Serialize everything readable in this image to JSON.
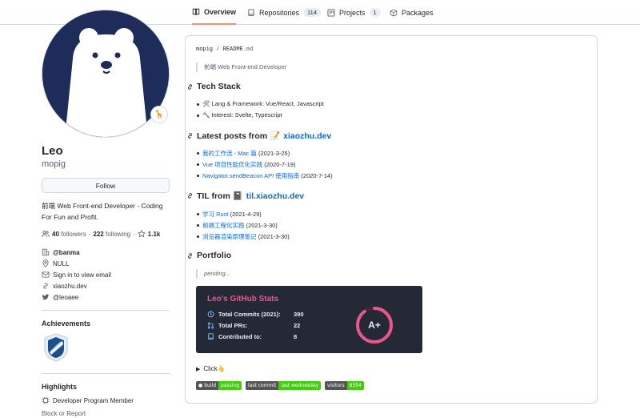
{
  "tabs": [
    {
      "label": "Overview",
      "icon": "book-icon",
      "active": true
    },
    {
      "label": "Repositories",
      "icon": "repo-icon",
      "count": "114"
    },
    {
      "label": "Projects",
      "icon": "project-icon",
      "count": "1"
    },
    {
      "label": "Packages",
      "icon": "package-icon"
    }
  ],
  "profile": {
    "status_emoji": "🦒",
    "name": "Leo",
    "login": "mopig",
    "follow_label": "Follow",
    "bio": "前端 Web Front-end Developer - Coding For Fun and Profit.",
    "followers_count": "40",
    "followers_label": "followers",
    "following_count": "222",
    "following_label": "following",
    "stars_count": "1.1k",
    "org": "@banma",
    "location": "NULL",
    "email": "Sign in to view email",
    "website": "xiaozhu.dev",
    "twitter": "@leoaee"
  },
  "achievements": {
    "heading": "Achievements"
  },
  "highlights": {
    "heading": "Highlights",
    "item": "Developer Program Member"
  },
  "block_label": "Block or Report",
  "readme": {
    "crumb_user": "mopig",
    "crumb_sep": "/",
    "crumb_file": "README",
    "crumb_ext": ".md",
    "intro": "前端 Web Front-end Developer",
    "tech_heading": "Tech Stack",
    "tech_items": [
      "🛠 Lang & Framework: Vue/React, Javascript",
      "🔨 Interest: Svelte, Typescript"
    ],
    "posts_heading_prefix": "Latest posts from 📝",
    "posts_heading_link": "xiaozhu.dev",
    "posts": [
      {
        "title": "我的工作流 - Mac 篇",
        "date": "(2021-3-25)"
      },
      {
        "title": "Vue 项目性能优化实践",
        "date": "(2020-7-19)"
      },
      {
        "title": "Navigator.sendBeacon API 使用指南",
        "date": "(2020-7-14)"
      }
    ],
    "til_heading_prefix": "TIL from 📓",
    "til_heading_link": "til.xiaozhu.dev",
    "til": [
      {
        "title": "学习 Rust",
        "date": "(2021-4-29)"
      },
      {
        "title": "前端工程化实践",
        "date": "(2021-3-30)"
      },
      {
        "title": "浏览器渲染原理笔记",
        "date": "(2021-3-30)"
      }
    ],
    "portfolio_heading": "Portfolio",
    "pending": "pending...",
    "click_label": "Click👆"
  },
  "stats": {
    "title": "Leo's GitHub Stats",
    "rows": [
      {
        "label": "Total Commits (2021):",
        "value": "390",
        "icon": "history-icon"
      },
      {
        "label": "Total PRs:",
        "value": "22",
        "icon": "pull-request-icon"
      },
      {
        "label": "Contributed to:",
        "value": "8",
        "icon": "repo-icon"
      }
    ],
    "rank": "A+",
    "rank_progress": 0.9,
    "accent": "#e8578b"
  },
  "shields": [
    {
      "left": "build",
      "right": "passing",
      "color": "#4c1"
    },
    {
      "left": "last commit",
      "right": "last wednesday",
      "color": "#4c1"
    },
    {
      "left": "visitors",
      "right": "8354",
      "color": "#4c1"
    }
  ]
}
